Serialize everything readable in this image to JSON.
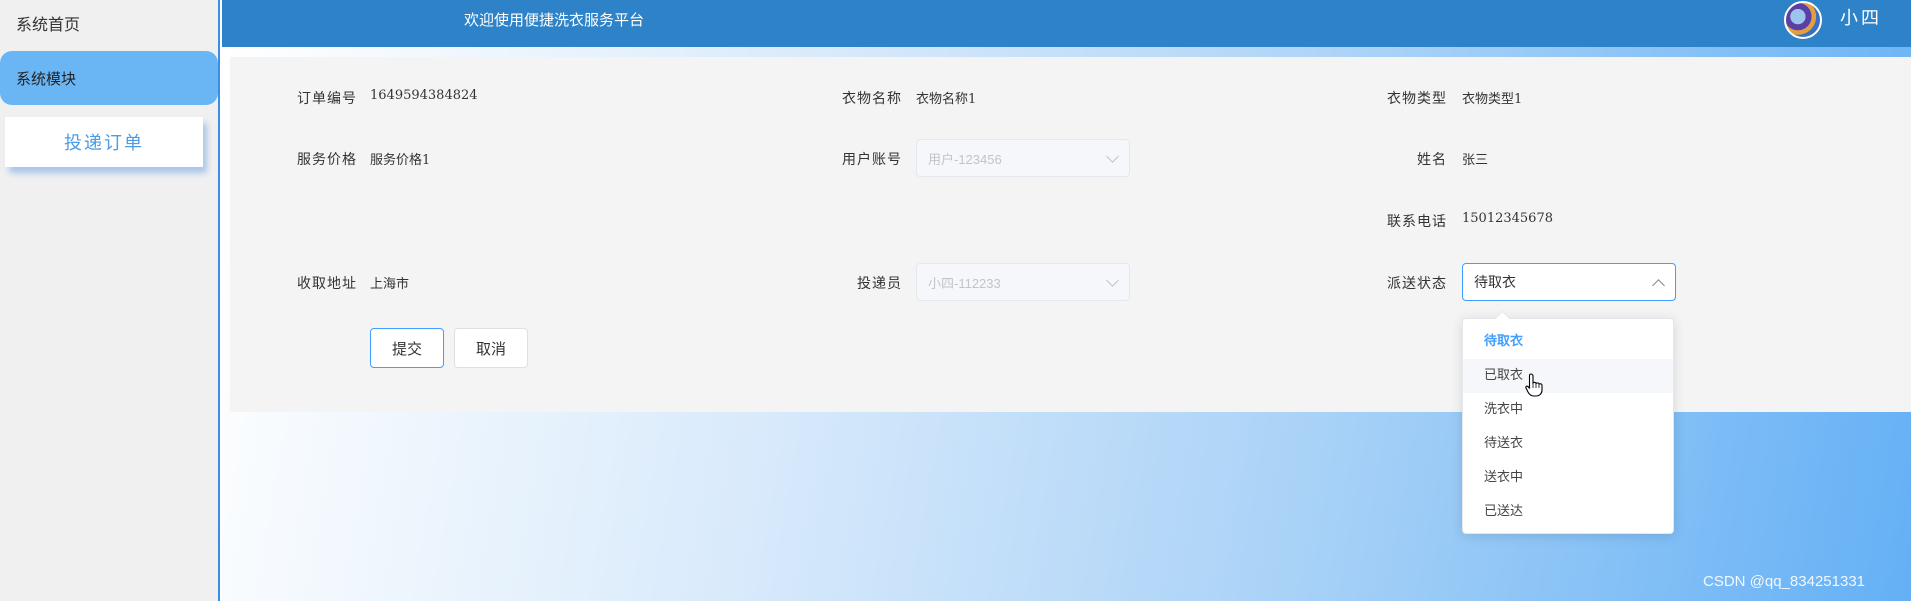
{
  "sidebar": {
    "home_label": "系统首页",
    "module_label": "系统模块",
    "sub_item_label": "投递订单"
  },
  "header": {
    "title": "欢迎使用便捷洗衣服务平台",
    "username": "小四"
  },
  "form": {
    "order_no": {
      "label": "订单编号",
      "value": "1649594384824"
    },
    "clothes_name": {
      "label": "衣物名称",
      "value": "衣物名称1"
    },
    "clothes_type": {
      "label": "衣物类型",
      "value": "衣物类型1"
    },
    "service_price": {
      "label": "服务价格",
      "value": "服务价格1"
    },
    "user_account": {
      "label": "用户账号",
      "value": "用户-123456"
    },
    "name": {
      "label": "姓名",
      "value": "张三"
    },
    "phone": {
      "label": "联系电话",
      "value": "15012345678"
    },
    "pickup_address": {
      "label": "收取地址",
      "value": "上海市"
    },
    "courier": {
      "label": "投递员",
      "value": "小四-112233"
    },
    "delivery_status": {
      "label": "派送状态",
      "value": "待取衣"
    }
  },
  "buttons": {
    "submit": "提交",
    "cancel": "取消"
  },
  "status_options": [
    "待取衣",
    "已取衣",
    "洗衣中",
    "待送衣",
    "送衣中",
    "已送达"
  ],
  "selected_option_index": 0,
  "hovered_option_index": 1,
  "watermark": "CSDN @qq_834251331",
  "colors": {
    "header_bg": "#2d82c8",
    "accent": "#409eff",
    "sidebar_active": "#6ab6f5"
  }
}
